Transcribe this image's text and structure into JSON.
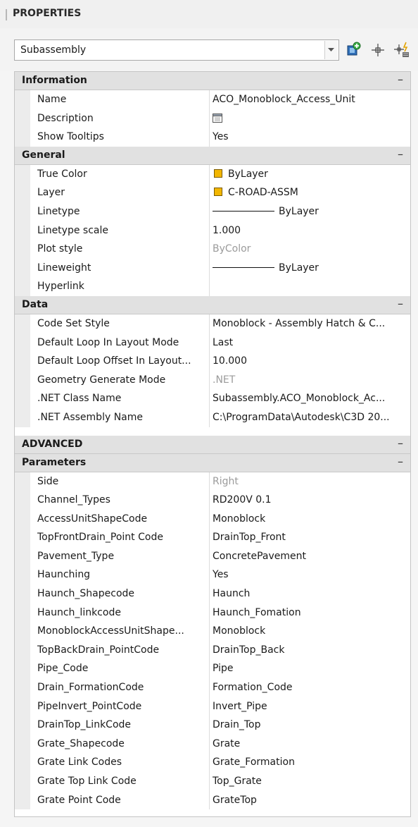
{
  "panel": {
    "title": "PROPERTIES"
  },
  "selector": {
    "value": "Subassembly"
  },
  "toolbar": {
    "icons": [
      "toggle-pickadd-icon",
      "select-objects-icon",
      "quick-select-icon"
    ]
  },
  "colors": {
    "swatch": "#f2b600",
    "category_bg": "#e1e1e1",
    "muted_text": "#9b9b9b"
  },
  "categories": {
    "information": {
      "label": "Information",
      "toggle": "–",
      "rows": [
        {
          "prop": "Name",
          "value": "ACO_Monoblock_Access_Unit"
        },
        {
          "prop": "Description",
          "value": ""
        },
        {
          "prop": "Show Tooltips",
          "value": "Yes"
        }
      ]
    },
    "general": {
      "label": "General",
      "toggle": "–",
      "rows": [
        {
          "prop": "True Color",
          "value": "ByLayer"
        },
        {
          "prop": "Layer",
          "value": "C-ROAD-ASSM"
        },
        {
          "prop": "Linetype",
          "value": "ByLayer"
        },
        {
          "prop": "Linetype scale",
          "value": "1.000"
        },
        {
          "prop": "Plot style",
          "value": "ByColor"
        },
        {
          "prop": "Lineweight",
          "value": "ByLayer"
        },
        {
          "prop": "Hyperlink",
          "value": ""
        }
      ]
    },
    "data": {
      "label": "Data",
      "toggle": "–",
      "rows": [
        {
          "prop": "Code Set Style",
          "value": "Monoblock - Assembly Hatch & C..."
        },
        {
          "prop": "Default Loop In Layout Mode",
          "value": "Last"
        },
        {
          "prop": "Default Loop Offset In Layout...",
          "value": "10.000"
        },
        {
          "prop": "Geometry Generate Mode",
          "value": ".NET"
        },
        {
          "prop": ".NET Class Name",
          "value": "Subassembly.ACO_Monoblock_Ac..."
        },
        {
          "prop": ".NET Assembly Name",
          "value": "C:\\ProgramData\\Autodesk\\C3D 20..."
        }
      ]
    },
    "advanced": {
      "label": "ADVANCED",
      "toggle": "–"
    },
    "parameters": {
      "label": "Parameters",
      "toggle": "–",
      "rows": [
        {
          "prop": "Side",
          "value": "Right"
        },
        {
          "prop": "Channel_Types",
          "value": "RD200V 0.1"
        },
        {
          "prop": "AccessUnitShapeCode",
          "value": "Monoblock"
        },
        {
          "prop": "TopFrontDrain_Point Code",
          "value": "DrainTop_Front"
        },
        {
          "prop": "Pavement_Type",
          "value": "ConcretePavement"
        },
        {
          "prop": "Haunching",
          "value": "Yes"
        },
        {
          "prop": "Haunch_Shapecode",
          "value": "Haunch"
        },
        {
          "prop": "Haunch_linkcode",
          "value": "Haunch_Fomation"
        },
        {
          "prop": "MonoblockAccessUnitShape...",
          "value": "Monoblock"
        },
        {
          "prop": "TopBackDrain_PointCode",
          "value": "DrainTop_Back"
        },
        {
          "prop": "Pipe_Code",
          "value": "Pipe"
        },
        {
          "prop": "Drain_FormationCode",
          "value": "Formation_Code"
        },
        {
          "prop": "PipeInvert_PointCode",
          "value": "Invert_Pipe"
        },
        {
          "prop": "DrainTop_LinkCode",
          "value": "Drain_Top"
        },
        {
          "prop": "Grate_Shapecode",
          "value": "Grate"
        },
        {
          "prop": "Grate Link Codes",
          "value": "Grate_Formation"
        },
        {
          "prop": "Grate Top Link Code",
          "value": "Top_Grate"
        },
        {
          "prop": "Grate Point Code",
          "value": "GrateTop"
        }
      ]
    }
  }
}
